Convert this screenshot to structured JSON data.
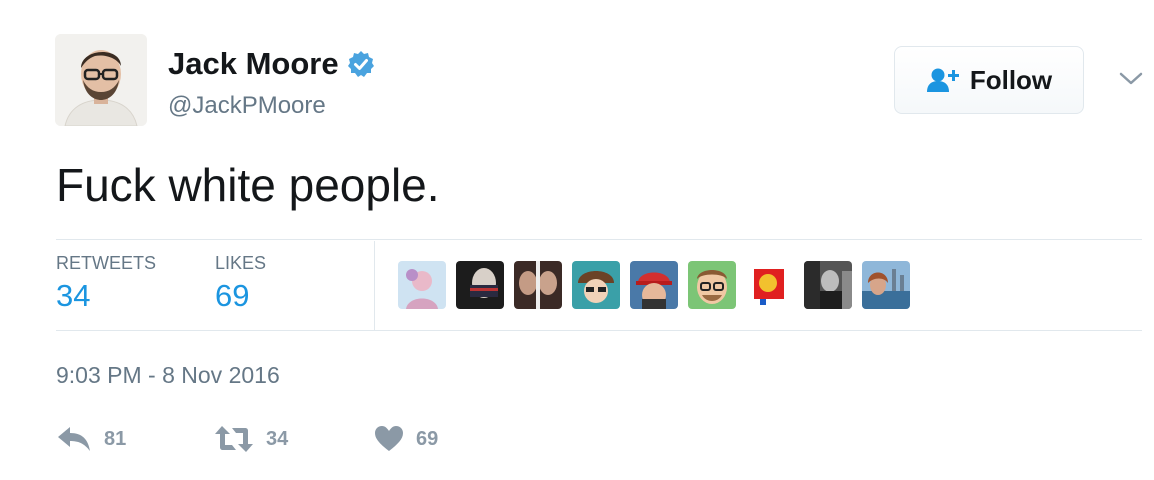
{
  "author": {
    "name": "Jack Moore",
    "handle": "@JackPMoore"
  },
  "header": {
    "follow_label": "Follow"
  },
  "tweet": {
    "text": "Fuck white people."
  },
  "stats": {
    "retweets_label": "RETWEETS",
    "retweets_value": "34",
    "likes_label": "LIKES",
    "likes_value": "69"
  },
  "timestamp": "9:03 PM - 8 Nov 2016",
  "actions": {
    "reply_count": "81",
    "retweet_count": "34",
    "like_count": "69"
  },
  "colors": {
    "link_blue": "#1b95e0",
    "verified_blue": "#4aa3df",
    "muted_gray": "#657786",
    "action_gray": "#8b99a6",
    "divider": "#e1e8ed"
  },
  "icons": [
    "verified-badge-icon",
    "follow-person-plus-icon",
    "chevron-down-icon",
    "reply-icon",
    "retweet-icon",
    "heart-icon"
  ]
}
